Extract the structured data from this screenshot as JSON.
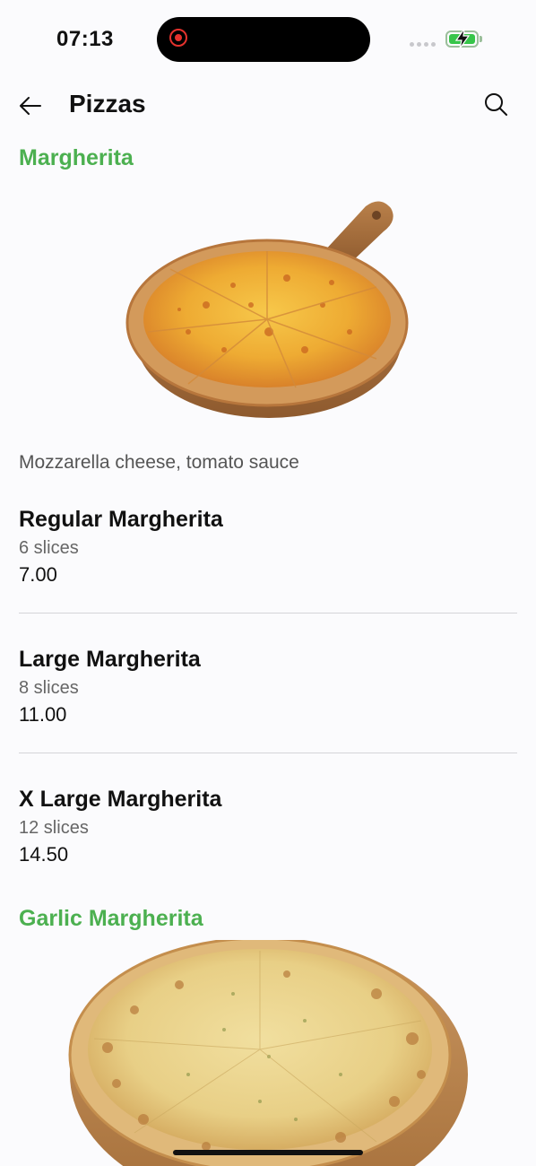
{
  "status_bar": {
    "time": "07:13",
    "battery_level": 1.0,
    "colors": {
      "battery": "#37c54a",
      "recording": "#e5322d"
    }
  },
  "header": {
    "title": "Pizzas",
    "back_icon": "arrow-left-icon",
    "search_icon": "search-icon"
  },
  "accent_color": "#4cb050",
  "sections": [
    {
      "title": "Margherita",
      "image": "margherita-pizza-on-wooden-board",
      "description": "Mozzarella cheese, tomato sauce",
      "items": [
        {
          "name": "Regular Margherita",
          "slices": "6 slices",
          "price": "7.00"
        },
        {
          "name": "Large Margherita",
          "slices": "8 slices",
          "price": "11.00"
        },
        {
          "name": "X Large Margherita",
          "slices": "12 slices",
          "price": "14.50"
        }
      ]
    },
    {
      "title": "Garlic Margherita",
      "image": "garlic-margherita-pizza-on-wooden-board"
    }
  ]
}
